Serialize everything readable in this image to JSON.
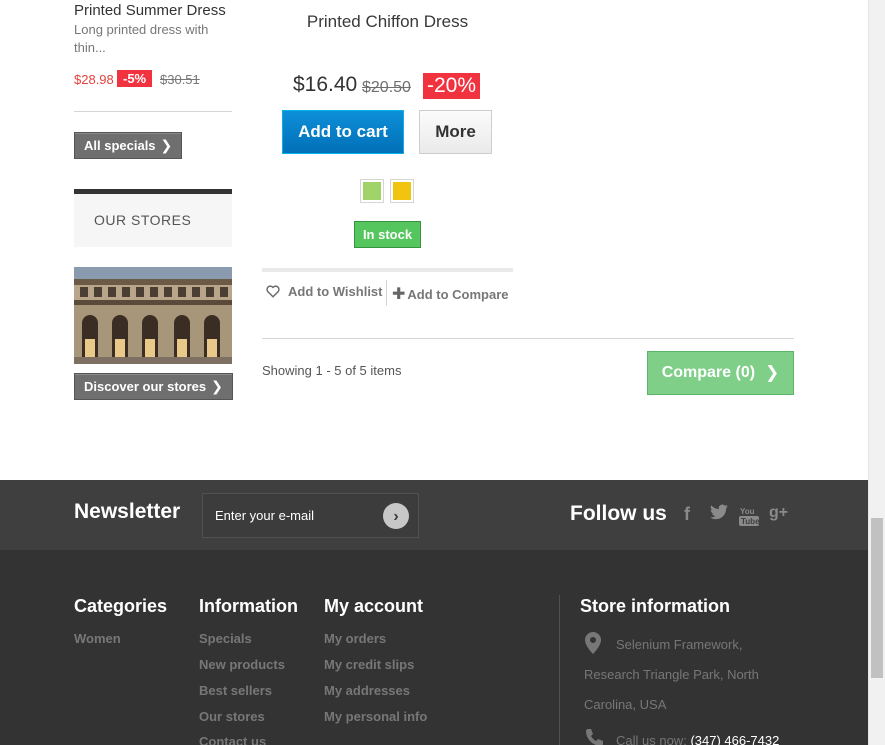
{
  "sidebar": {
    "special_product": {
      "name": "Printed Summer Dress",
      "description": "Long printed dress with thin...",
      "price": "$28.98",
      "discount": "-5%",
      "old_price": "$30.51"
    },
    "all_specials_label": "All specials",
    "our_stores_title": "OUR STORES",
    "discover_stores_label": "Discover our stores"
  },
  "product": {
    "name": "Printed Chiffon Dress",
    "price": "$16.40",
    "old_price": "$20.50",
    "discount": "-20%",
    "add_to_cart_label": "Add to cart",
    "more_label": "More",
    "colors": [
      "#a0d468",
      "#f1c40f"
    ],
    "availability": "In stock",
    "wishlist_label": "Add to Wishlist",
    "compare_label": "Add to Compare"
  },
  "listing": {
    "showing_text": "Showing 1 - 5 of 5 items",
    "compare_button_label": "Compare (0)"
  },
  "footer": {
    "newsletter": {
      "title": "Newsletter",
      "placeholder": "Enter your e-mail"
    },
    "follow": {
      "title": "Follow us",
      "icons": [
        "facebook-icon",
        "twitter-icon",
        "youtube-icon",
        "google-plus-icon"
      ]
    },
    "categories": {
      "title": "Categories",
      "links": [
        "Women"
      ]
    },
    "information": {
      "title": "Information",
      "links": [
        "Specials",
        "New products",
        "Best sellers",
        "Our stores",
        "Contact us"
      ]
    },
    "my_account": {
      "title": "My account",
      "links": [
        "My orders",
        "My credit slips",
        "My addresses",
        "My personal info"
      ]
    },
    "store_info": {
      "title": "Store information",
      "address_line1": "Selenium Framework,",
      "address_line2": "Research Triangle Park, North",
      "address_line3": "Carolina, USA",
      "call_label": "Call us now:",
      "phone": "(347) 466-7432"
    }
  }
}
